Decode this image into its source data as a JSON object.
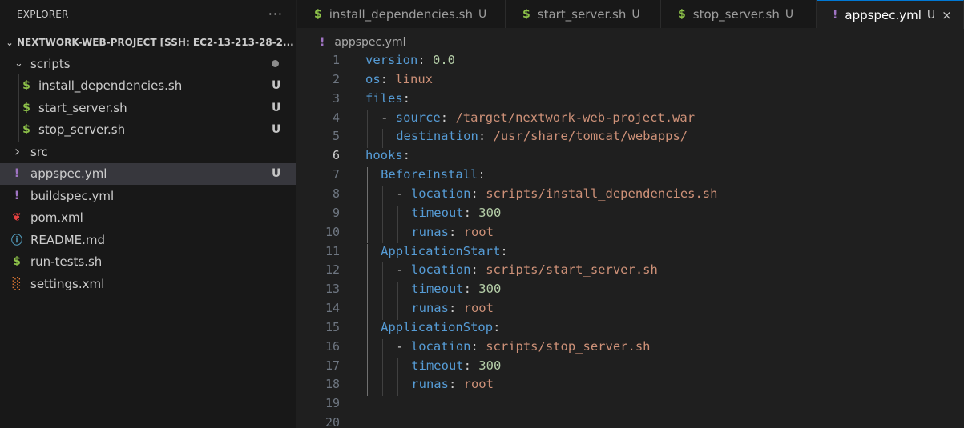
{
  "explorer": {
    "title": "EXPLORER",
    "more_label": "···",
    "project": "NEXTWORK-WEB-PROJECT [SSH: EC2-13-213-28-2...",
    "items": [
      {
        "label": "scripts",
        "type": "folder",
        "expanded": true,
        "indent": 0,
        "status": "dot"
      },
      {
        "label": "install_dependencies.sh",
        "type": "sh",
        "indent": 1,
        "status": "U"
      },
      {
        "label": "start_server.sh",
        "type": "sh",
        "indent": 1,
        "status": "U"
      },
      {
        "label": "stop_server.sh",
        "type": "sh",
        "indent": 1,
        "status": "U"
      },
      {
        "label": "src",
        "type": "folder",
        "expanded": false,
        "indent": 0,
        "status": ""
      },
      {
        "label": "appspec.yml",
        "type": "yml",
        "indent": 0,
        "status": "U",
        "selected": true
      },
      {
        "label": "buildspec.yml",
        "type": "yml",
        "indent": 0,
        "status": ""
      },
      {
        "label": "pom.xml",
        "type": "pom",
        "indent": 0,
        "status": ""
      },
      {
        "label": "README.md",
        "type": "info",
        "indent": 0,
        "status": ""
      },
      {
        "label": "run-tests.sh",
        "type": "sh",
        "indent": 0,
        "status": ""
      },
      {
        "label": "settings.xml",
        "type": "xml",
        "indent": 0,
        "status": ""
      }
    ]
  },
  "icons": {
    "sh": "$",
    "yml": "!",
    "pom": "❦",
    "info": "ⓘ",
    "xml": "░",
    "chevron_down": "⌄",
    "chevron_right": "›",
    "close": "×"
  },
  "colors": {
    "accent": "#0078d4",
    "sh_icon": "#8dc149",
    "yml_icon": "#a074c4",
    "keyword": "#569cd6",
    "string": "#ce9178",
    "number": "#b5cea8"
  },
  "tabs": [
    {
      "label": "install_dependencies.sh",
      "type": "sh",
      "badge": "U",
      "active": false
    },
    {
      "label": "start_server.sh",
      "type": "sh",
      "badge": "U",
      "active": false
    },
    {
      "label": "stop_server.sh",
      "type": "sh",
      "badge": "U",
      "active": false
    },
    {
      "label": "appspec.yml",
      "type": "yml",
      "badge": "U",
      "active": true
    }
  ],
  "breadcrumb": {
    "file": "appspec.yml"
  },
  "editor": {
    "current_line": 6,
    "lines": [
      {
        "n": "1",
        "indent": 0,
        "tokens": [
          [
            "k",
            "version"
          ],
          [
            "p",
            ": "
          ],
          [
            "n",
            "0.0"
          ]
        ]
      },
      {
        "n": "2",
        "indent": 0,
        "tokens": [
          [
            "k",
            "os"
          ],
          [
            "p",
            ": "
          ],
          [
            "s",
            "linux"
          ]
        ]
      },
      {
        "n": "3",
        "indent": 0,
        "tokens": [
          [
            "k",
            "files"
          ],
          [
            "p",
            ":"
          ]
        ]
      },
      {
        "n": "4",
        "indent": 1,
        "tokens": [
          [
            "p",
            "- "
          ],
          [
            "k",
            "source"
          ],
          [
            "p",
            ": "
          ],
          [
            "s",
            "/target/nextwork-web-project.war"
          ]
        ]
      },
      {
        "n": "5",
        "indent": 2,
        "tokens": [
          [
            "k",
            "destination"
          ],
          [
            "p",
            ": "
          ],
          [
            "s",
            "/usr/share/tomcat/webapps/"
          ]
        ]
      },
      {
        "n": "6",
        "indent": 0,
        "tokens": [
          [
            "k",
            "hooks"
          ],
          [
            "p",
            ":"
          ]
        ]
      },
      {
        "n": "7",
        "indent": 1,
        "tokens": [
          [
            "k",
            "BeforeInstall"
          ],
          [
            "p",
            ":"
          ]
        ]
      },
      {
        "n": "8",
        "indent": 2,
        "tokens": [
          [
            "p",
            "- "
          ],
          [
            "k",
            "location"
          ],
          [
            "p",
            ": "
          ],
          [
            "s",
            "scripts/install_dependencies.sh"
          ]
        ]
      },
      {
        "n": "9",
        "indent": 3,
        "tokens": [
          [
            "k",
            "timeout"
          ],
          [
            "p",
            ": "
          ],
          [
            "n",
            "300"
          ]
        ]
      },
      {
        "n": "10",
        "indent": 3,
        "tokens": [
          [
            "k",
            "runas"
          ],
          [
            "p",
            ": "
          ],
          [
            "s",
            "root"
          ]
        ]
      },
      {
        "n": "11",
        "indent": 1,
        "tokens": [
          [
            "k",
            "ApplicationStart"
          ],
          [
            "p",
            ":"
          ]
        ]
      },
      {
        "n": "12",
        "indent": 2,
        "tokens": [
          [
            "p",
            "- "
          ],
          [
            "k",
            "location"
          ],
          [
            "p",
            ": "
          ],
          [
            "s",
            "scripts/start_server.sh"
          ]
        ]
      },
      {
        "n": "13",
        "indent": 3,
        "tokens": [
          [
            "k",
            "timeout"
          ],
          [
            "p",
            ": "
          ],
          [
            "n",
            "300"
          ]
        ]
      },
      {
        "n": "14",
        "indent": 3,
        "tokens": [
          [
            "k",
            "runas"
          ],
          [
            "p",
            ": "
          ],
          [
            "s",
            "root"
          ]
        ]
      },
      {
        "n": "15",
        "indent": 1,
        "tokens": [
          [
            "k",
            "ApplicationStop"
          ],
          [
            "p",
            ":"
          ]
        ]
      },
      {
        "n": "16",
        "indent": 2,
        "tokens": [
          [
            "p",
            "- "
          ],
          [
            "k",
            "location"
          ],
          [
            "p",
            ": "
          ],
          [
            "s",
            "scripts/stop_server.sh"
          ]
        ]
      },
      {
        "n": "17",
        "indent": 3,
        "tokens": [
          [
            "k",
            "timeout"
          ],
          [
            "p",
            ": "
          ],
          [
            "n",
            "300"
          ]
        ]
      },
      {
        "n": "18",
        "indent": 3,
        "tokens": [
          [
            "k",
            "runas"
          ],
          [
            "p",
            ": "
          ],
          [
            "s",
            "root"
          ]
        ]
      },
      {
        "n": "19",
        "indent": 0,
        "tokens": []
      },
      {
        "n": "20",
        "indent": 0,
        "tokens": []
      }
    ]
  }
}
